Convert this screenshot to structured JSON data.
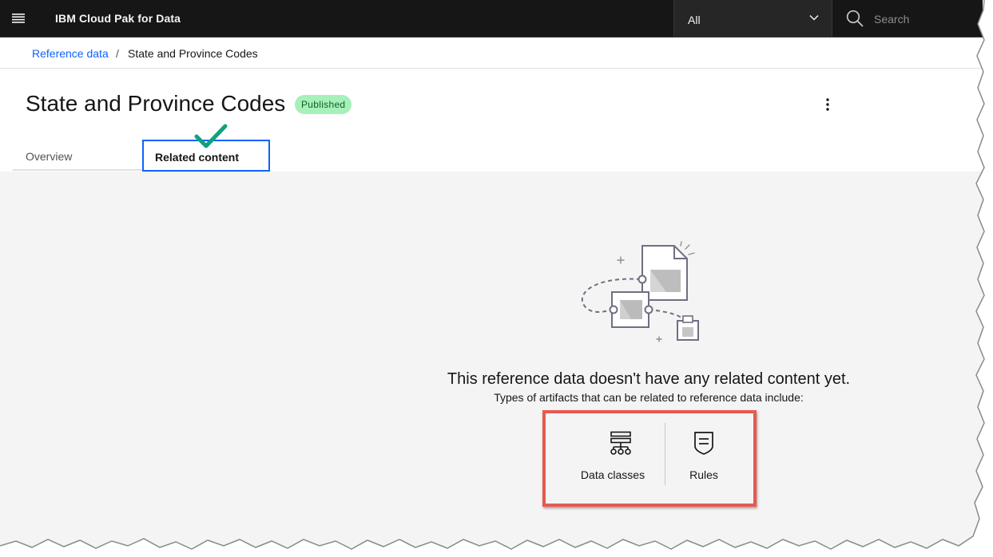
{
  "header": {
    "product_name": "IBM Cloud Pak for Data",
    "scope_value": "All",
    "search_placeholder": "Search"
  },
  "breadcrumb": {
    "parent": "Reference data",
    "separator": "/",
    "current": "State and Province Codes"
  },
  "page": {
    "title": "State and Province Codes",
    "status_badge": "Published",
    "status_color": "#a7f0ba"
  },
  "tabs": [
    {
      "label": "Overview",
      "selected": false
    },
    {
      "label": "Related content",
      "selected": true
    }
  ],
  "empty_state": {
    "title": "This reference data doesn't have any related content yet.",
    "subtitle": "Types of artifacts that can be related to reference data include:",
    "artifact_types": [
      {
        "label": "Data classes",
        "icon": "data-class-icon"
      },
      {
        "label": "Rules",
        "icon": "rule-icon"
      }
    ]
  },
  "annotations": {
    "highlight_color": "#e8594f",
    "checkmark_color": "#12a07e"
  }
}
